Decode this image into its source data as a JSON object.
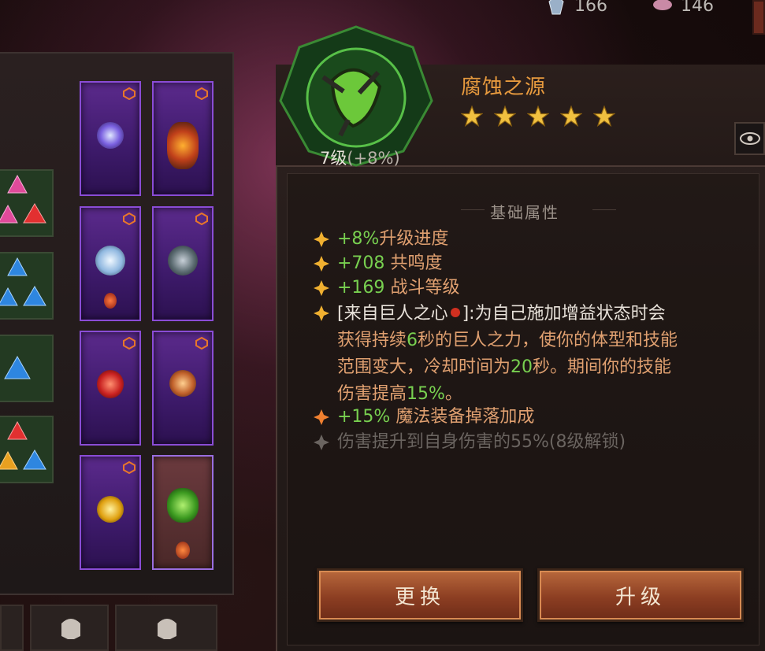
{
  "resources": [
    {
      "icon": "crystal-icon",
      "value": "166"
    },
    {
      "icon": "platinum-icon",
      "value": "146"
    }
  ],
  "item": {
    "name": "腐蚀之源",
    "stars": 5,
    "level": "7级",
    "level_progress": "(+8%)"
  },
  "section_title": "基础属性",
  "attributes": {
    "a1_value": "+8%",
    "a1_label": "升级进度",
    "a2_value": "+708",
    "a2_label": "共鸣度",
    "a3_value": "+169",
    "a3_label": "战斗等级",
    "a5_value": "+15%",
    "a5_label": "魔法装备掉落加成",
    "a6_locked": "伤害提升到自身伤害的55%(8级解锁)"
  },
  "effect": {
    "prefix": "[来自巨人之心",
    "suffix": "]:为自己施加增益状态时会",
    "line2a": "获得持续",
    "line2b": "6",
    "line2c": "秒的巨人之力，使你的体型和技能",
    "line3a": "范围变大，冷却时间为",
    "line3b": "20",
    "line3c": "秒。期间你的技能",
    "line4a": "伤害提高",
    "line4b": "15%",
    "line4c": "。"
  },
  "buttons": {
    "replace": "更换",
    "upgrade": "升级"
  },
  "colors": {
    "orange_text": "#e0a070",
    "green_text": "#78d050",
    "title_orange": "#e79a3e",
    "slot_purple": "#5b2a8c"
  }
}
